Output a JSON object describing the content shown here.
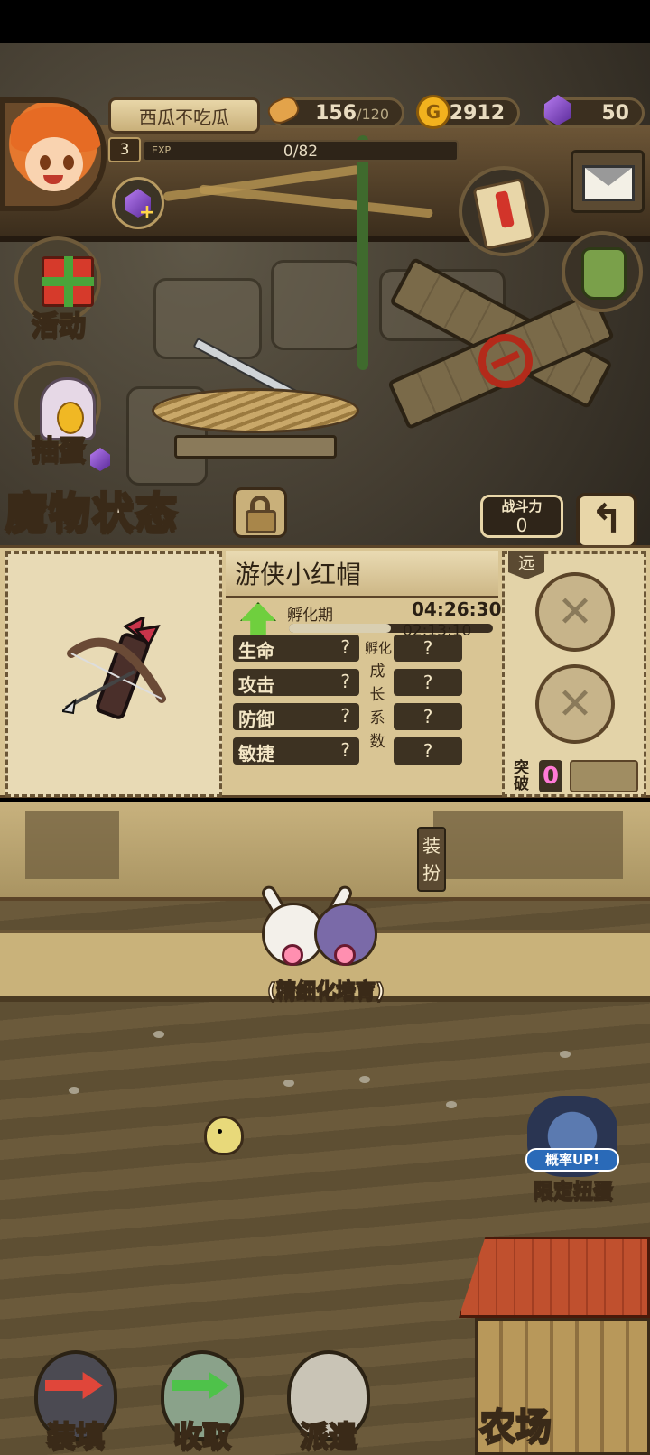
{
  "player": {
    "name": "西瓜不吃瓜",
    "level": "3",
    "exp_label": "EXP",
    "exp_value": "0/82"
  },
  "resources": {
    "bread": "156",
    "bread_max": "/120",
    "gold_symbol": "G",
    "gold": "2912",
    "gems": "50"
  },
  "side_menu": {
    "activity_label": "活动",
    "gacha_label": "抽蛋"
  },
  "monster_status": {
    "title": "魔物状态",
    "power_label": "战斗力",
    "power_value": "0",
    "back_symbol": "↰"
  },
  "monster": {
    "name": "游侠小红帽",
    "phase_label": "孵化期",
    "timer_total": "04:26:30",
    "timer_remaining": "02:13:10",
    "progress": 0.5,
    "hatch_label": "孵化",
    "growth_chars": [
      "成",
      "长",
      "系",
      "数"
    ],
    "stats": [
      {
        "label": "生命",
        "value": "?",
        "growth": "?"
      },
      {
        "label": "攻击",
        "value": "?",
        "growth": "?"
      },
      {
        "label": "防御",
        "value": "?",
        "growth": "?"
      },
      {
        "label": "敏捷",
        "value": "?",
        "growth": "?"
      }
    ],
    "range_tag": "远",
    "breakthrough_label": "突破",
    "breakthrough_value": "0"
  },
  "dress_label": "装扮",
  "farm": {
    "breeding_label": "(精细化培育)",
    "limited_up_badge": "概率UP!",
    "limited_label": "限定扭蛋",
    "farm_label": "农场"
  },
  "bottom_actions": [
    {
      "label": "装填"
    },
    {
      "label": "收取"
    },
    {
      "label": "派遣"
    }
  ],
  "colors": {
    "panel_bg": "#d9c594",
    "accent_green": "#6fcf3e",
    "breakthrough_pink": "#ff7ad6"
  }
}
